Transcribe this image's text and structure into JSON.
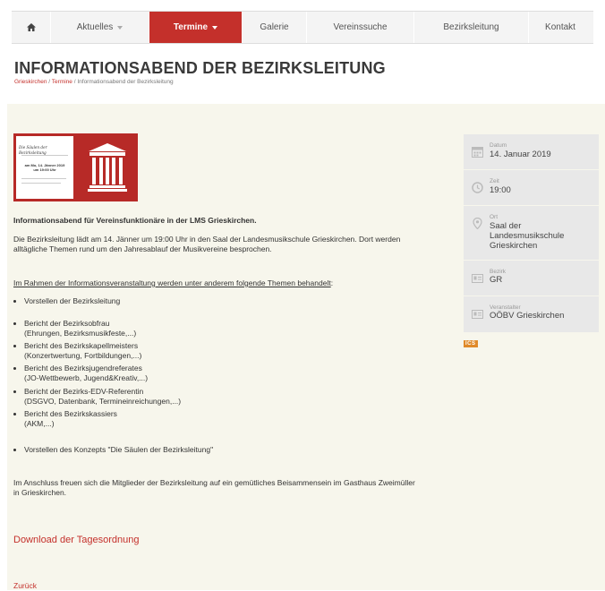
{
  "nav": {
    "home_icon": "home-icon",
    "items": [
      {
        "label": "Aktuelles",
        "dropdown": true,
        "active": false
      },
      {
        "label": "Termine",
        "dropdown": true,
        "active": true
      },
      {
        "label": "Galerie",
        "dropdown": false,
        "active": false
      },
      {
        "label": "Vereinssuche",
        "dropdown": false,
        "active": false
      },
      {
        "label": "Bezirksleitung",
        "dropdown": false,
        "active": false
      },
      {
        "label": "Kontakt",
        "dropdown": false,
        "active": false
      }
    ]
  },
  "page": {
    "title": "INFORMATIONSABEND DER BEZIRKSLEITUNG",
    "breadcrumb": [
      {
        "label": "Grieskirchen",
        "link": true
      },
      {
        "label": " / ",
        "link": false
      },
      {
        "label": "Termine",
        "link": true
      },
      {
        "label": " / Informationsabend der Bezirksleitung",
        "link": false
      }
    ]
  },
  "flyer": {
    "title": "Die Säulen der Bezirksleitung",
    "date_line1": "am Mo, 14. Jänner 2019",
    "date_line2": "um 19:00 Uhr"
  },
  "article": {
    "heading": "Informationsabend für Vereinsfunktionäre in der LMS Grieskirchen.",
    "intro_line1": "Die Bezirksleitung lädt am 14. Jänner um 19:00 Uhr in den Saal der Landesmusikschule Grieskirchen. Dort werden",
    "intro_line2": "alltägliche Themen rund um den Jahresablauf der Musikvereine besprochen.",
    "topics_heading": "Im Rahmen der Informationsveranstaltung werden unter anderem folgende Themen behandelt",
    "topics_colon": ":",
    "topics": [
      {
        "line1": "Vorstellen der Bezirksleitung",
        "line2": ""
      },
      {
        "line1": "Bericht der Bezirksobfrau",
        "line2": "(Ehrungen, Bezirksmusikfeste,...)"
      },
      {
        "line1": "Bericht des Bezirkskapellmeisters",
        "line2": "(Konzertwertung, Fortbildungen,...)"
      },
      {
        "line1": "Bericht des Bezirksjugendreferates",
        "line2": "(JO-Wettbewerb, Jugend&Kreativ,...)"
      },
      {
        "line1": "Bericht der Bezirks-EDV-Referentin",
        "line2": "(DSGVO, Datenbank, Termineinreichungen,...)"
      },
      {
        "line1": "Bericht des Bezirkskassiers",
        "line2": "(AKM,...)"
      },
      {
        "line1": "Vorstellen des Konzepts \"Die Säulen der Bezirksleitung\"",
        "line2": ""
      }
    ],
    "closing_line1": "Im Anschluss freuen sich die Mitglieder der Bezirksleitung auf ein gemütliches Beisammensein im Gasthaus Zweimüller",
    "closing_line2": "in Grieskirchen.",
    "download_label": "Download der Tagesordnung",
    "back_label": "Zurück"
  },
  "sidebar": {
    "rows": [
      {
        "label": "Datum",
        "value": "14. Januar 2019",
        "value2": "",
        "icon": "calendar-icon"
      },
      {
        "label": "Zeit",
        "value": "19:00",
        "value2": "",
        "icon": "clock-icon"
      },
      {
        "label": "Ort",
        "value": "Saal der Landesmusikschule",
        "value2": "Grieskirchen",
        "icon": "location-pin-icon"
      },
      {
        "label": "Bezirk",
        "value": "GR",
        "value2": "",
        "icon": "id-card-icon"
      },
      {
        "label": "Veranstalter",
        "value": "OÖBV Grieskirchen",
        "value2": "",
        "icon": "id-card-icon"
      }
    ],
    "ics_label": "ICS"
  },
  "colors": {
    "accent": "#c4302b",
    "content_bg": "#f7f6ec",
    "sidebar_bg": "#e8e8e8"
  }
}
